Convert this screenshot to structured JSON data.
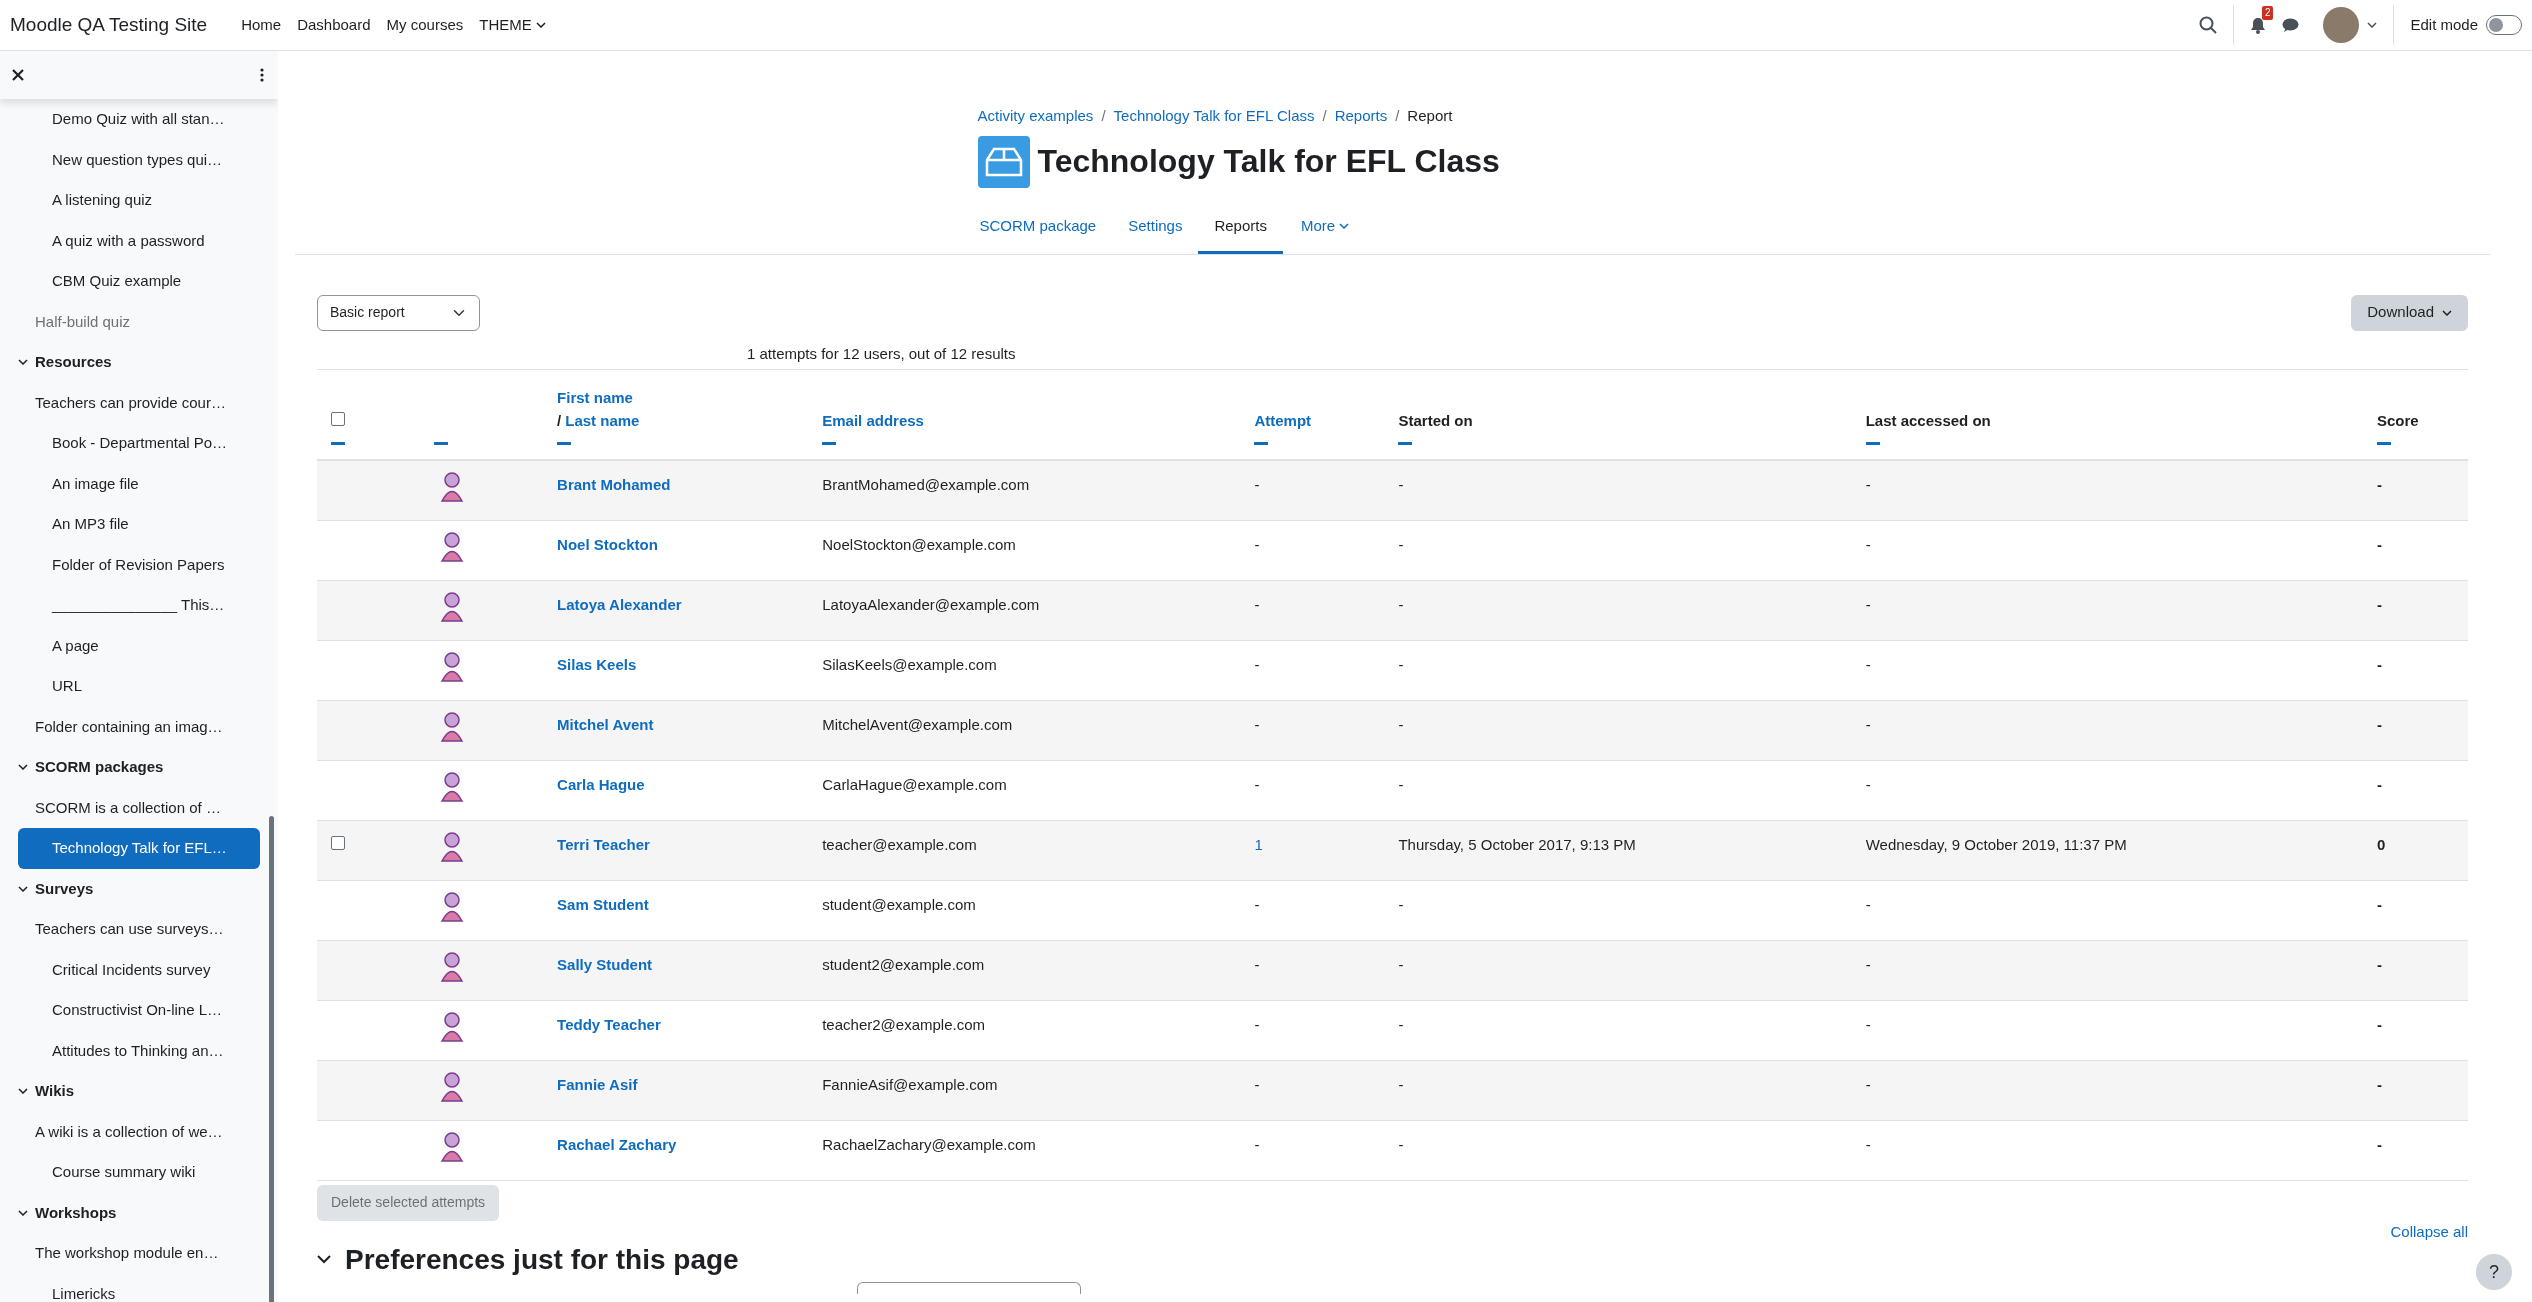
{
  "navbar": {
    "brand": "Moodle QA Testing Site",
    "links": [
      {
        "label": "Home",
        "dropdown": false
      },
      {
        "label": "Dashboard",
        "dropdown": false
      },
      {
        "label": "My courses",
        "dropdown": false
      },
      {
        "label": "THEME",
        "dropdown": true
      }
    ],
    "notification_count": "2",
    "edit_mode": {
      "label": "Edit mode",
      "on": false
    }
  },
  "sidebar": {
    "items": [
      {
        "kind": "partial",
        "children": [
          {
            "kind": "partial",
            "children": [
              {
                "label": "Demo Quiz with all stan…",
                "selected": false,
                "dimmed": false
              },
              {
                "label": "New question types qui…",
                "selected": false,
                "dimmed": false
              },
              {
                "label": "A listening quiz",
                "selected": false,
                "dimmed": false
              },
              {
                "label": "A quiz with a password",
                "selected": false,
                "dimmed": false
              },
              {
                "label": "CBM Quiz example",
                "selected": false,
                "dimmed": false
              }
            ]
          },
          {
            "label": "Half-build quiz",
            "selected": false,
            "dimmed": true
          }
        ]
      },
      {
        "kind": "section",
        "label": "Resources",
        "expanded": true,
        "children": [
          {
            "label": "Teachers can provide cour…",
            "selected": false,
            "dimmed": false,
            "children": [
              {
                "label": "Book - Departmental Po…",
                "selected": false,
                "dimmed": false
              },
              {
                "label": "An image file",
                "selected": false,
                "dimmed": false
              },
              {
                "label": "An MP3 file",
                "selected": false,
                "dimmed": false
              },
              {
                "label": "Folder of Revision Papers",
                "selected": false,
                "dimmed": false
              },
              {
                "label": "_______________ This…",
                "selected": false,
                "dimmed": false
              },
              {
                "label": "A page",
                "selected": false,
                "dimmed": false
              },
              {
                "label": "URL",
                "selected": false,
                "dimmed": false
              }
            ]
          },
          {
            "label": "Folder containing an imag…",
            "selected": false,
            "dimmed": false
          }
        ]
      },
      {
        "kind": "section",
        "label": "SCORM packages",
        "expanded": true,
        "children": [
          {
            "label": "SCORM is a collection of …",
            "selected": false,
            "dimmed": false,
            "children": [
              {
                "label": "Technology Talk for EFL…",
                "selected": true
              }
            ]
          }
        ]
      },
      {
        "kind": "section",
        "label": "Surveys",
        "expanded": true,
        "children": [
          {
            "label": "Teachers can use surveys…",
            "selected": false,
            "dimmed": false,
            "children": [
              {
                "label": "Critical Incidents survey",
                "selected": false,
                "dimmed": false
              },
              {
                "label": "Constructivist On-line L…",
                "selected": false,
                "dimmed": false
              },
              {
                "label": "Attitudes to Thinking an…",
                "selected": false,
                "dimmed": false
              }
            ]
          }
        ]
      },
      {
        "kind": "section",
        "label": "Wikis",
        "expanded": true,
        "children": [
          {
            "label": "A wiki is a collection of we…",
            "selected": false,
            "dimmed": false,
            "children": [
              {
                "label": "Course summary wiki",
                "selected": false,
                "dimmed": false
              }
            ]
          }
        ]
      },
      {
        "kind": "section",
        "label": "Workshops",
        "expanded": true,
        "children": [
          {
            "label": "The workshop module en…",
            "selected": false,
            "dimmed": false,
            "children": [
              {
                "label": "Limericks",
                "selected": false,
                "dimmed": false
              }
            ]
          }
        ]
      }
    ]
  },
  "breadcrumb": [
    {
      "label": "Activity examples",
      "link": true
    },
    {
      "separator": "/",
      "label": "Technology Talk for EFL Class",
      "link": true
    },
    {
      "separator": "/",
      "label": "Reports",
      "link": true
    },
    {
      "separator": "/",
      "label": "Report",
      "link": false
    }
  ],
  "title": "Technology Talk for EFL Class",
  "tabs": [
    {
      "label": "SCORM package",
      "selected": false,
      "dropdown": false
    },
    {
      "label": "Settings",
      "selected": false,
      "dropdown": false
    },
    {
      "label": "Reports",
      "selected": true,
      "dropdown": false
    },
    {
      "label": "More",
      "selected": false,
      "dropdown": true
    }
  ],
  "report_select": {
    "value": "Basic report"
  },
  "download_button": "Download",
  "summary": "1 attempts for 12 users, out of 12 results",
  "table": {
    "columns": [
      {
        "kind": "checkbox",
        "checked": false
      },
      {
        "kind": "picture"
      },
      {
        "kind": "fullname",
        "labels": [
          "First name",
          "Last name"
        ],
        "separator": "/"
      },
      {
        "kind": "sortable",
        "label": "Email address"
      },
      {
        "kind": "sortable",
        "label": "Attempt"
      },
      {
        "kind": "plain",
        "label": "Started on"
      },
      {
        "kind": "plain",
        "label": "Last accessed on"
      },
      {
        "kind": "plain",
        "label": "Score"
      }
    ],
    "rows": [
      {
        "selectable": false,
        "name": "Brant Mohamed",
        "email": "BrantMohamed@example.com",
        "attempt": "-",
        "attempt_link": false,
        "started": "-",
        "last_accessed": "-",
        "score": "-"
      },
      {
        "selectable": false,
        "name": "Noel Stockton",
        "email": "NoelStockton@example.com",
        "attempt": "-",
        "attempt_link": false,
        "started": "-",
        "last_accessed": "-",
        "score": "-"
      },
      {
        "selectable": false,
        "name": "Latoya Alexander",
        "email": "LatoyaAlexander@example.com",
        "attempt": "-",
        "attempt_link": false,
        "started": "-",
        "last_accessed": "-",
        "score": "-"
      },
      {
        "selectable": false,
        "name": "Silas Keels",
        "email": "SilasKeels@example.com",
        "attempt": "-",
        "attempt_link": false,
        "started": "-",
        "last_accessed": "-",
        "score": "-"
      },
      {
        "selectable": false,
        "name": "Mitchel Avent",
        "email": "MitchelAvent@example.com",
        "attempt": "-",
        "attempt_link": false,
        "started": "-",
        "last_accessed": "-",
        "score": "-"
      },
      {
        "selectable": false,
        "name": "Carla Hague",
        "email": "CarlaHague@example.com",
        "attempt": "-",
        "attempt_link": false,
        "started": "-",
        "last_accessed": "-",
        "score": "-"
      },
      {
        "selectable": true,
        "checked": false,
        "name": "Terri Teacher",
        "email": "teacher@example.com",
        "attempt": "1",
        "attempt_link": true,
        "started": "Thursday, 5 October 2017, 9:13 PM",
        "last_accessed": "Wednesday, 9 October 2019, 11:37 PM",
        "score": "0"
      },
      {
        "selectable": false,
        "name": "Sam Student",
        "email": "student@example.com",
        "attempt": "-",
        "attempt_link": false,
        "started": "-",
        "last_accessed": "-",
        "score": "-"
      },
      {
        "selectable": false,
        "name": "Sally Student",
        "email": "student2@example.com",
        "attempt": "-",
        "attempt_link": false,
        "started": "-",
        "last_accessed": "-",
        "score": "-"
      },
      {
        "selectable": false,
        "name": "Teddy Teacher",
        "email": "teacher2@example.com",
        "attempt": "-",
        "attempt_link": false,
        "started": "-",
        "last_accessed": "-",
        "score": "-"
      },
      {
        "selectable": false,
        "name": "Fannie Asif",
        "email": "FannieAsif@example.com",
        "attempt": "-",
        "attempt_link": false,
        "started": "-",
        "last_accessed": "-",
        "score": "-"
      },
      {
        "selectable": false,
        "name": "Rachael Zachary",
        "email": "RachaelZachary@example.com",
        "attempt": "-",
        "attempt_link": false,
        "started": "-",
        "last_accessed": "-",
        "score": "-"
      }
    ]
  },
  "delete_button": {
    "label": "Delete selected attempts",
    "disabled": true
  },
  "collapse_all": "Collapse all",
  "preferences_heading": {
    "label": "Preferences just for this page",
    "expanded": true
  },
  "help_button": "?"
}
